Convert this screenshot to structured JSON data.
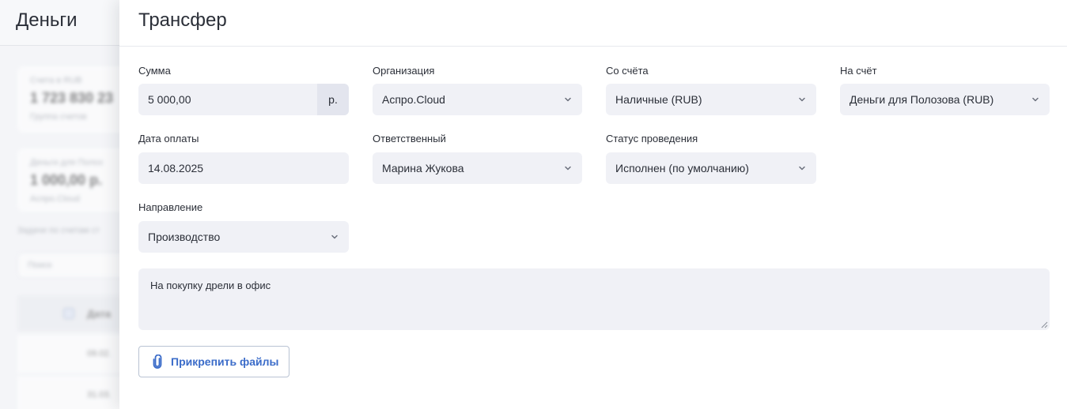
{
  "background": {
    "title": "Деньги",
    "cards": [
      {
        "label": "Счета в RUB",
        "value": "1 723 830 23",
        "sub": "Группа счетов"
      },
      {
        "label": "Деньги для Полоз",
        "value": "1 000,00 р.",
        "sub": "Аспро.Cloud"
      }
    ],
    "note": "Задачи по счетам ст",
    "search_placeholder": "Поиск",
    "table_header": "Дата",
    "rows": [
      "09.02.",
      "31.03."
    ]
  },
  "modal": {
    "title": "Трансфер",
    "fields": {
      "amount": {
        "label": "Сумма",
        "value": "5 000,00",
        "suffix": "р."
      },
      "organization": {
        "label": "Организация",
        "value": "Аспро.Cloud"
      },
      "from_account": {
        "label": "Со счёта",
        "value": "Наличные (RUB)"
      },
      "to_account": {
        "label": "На счёт",
        "value": "Деньги для Полозова (RUB)"
      },
      "payment_date": {
        "label": "Дата оплаты",
        "value": "14.08.2025"
      },
      "responsible": {
        "label": "Ответственный",
        "value": "Марина Жукова"
      },
      "status": {
        "label": "Статус проведения",
        "value": "Исполнен (по умолчанию)"
      },
      "direction": {
        "label": "Направление",
        "value": "Производство"
      }
    },
    "comment": "На покупку дрели в офис",
    "attach_button": "Прикрепить файлы"
  },
  "colors": {
    "accent": "#3b6cc9",
    "input_bg": "#f0f1f6"
  }
}
